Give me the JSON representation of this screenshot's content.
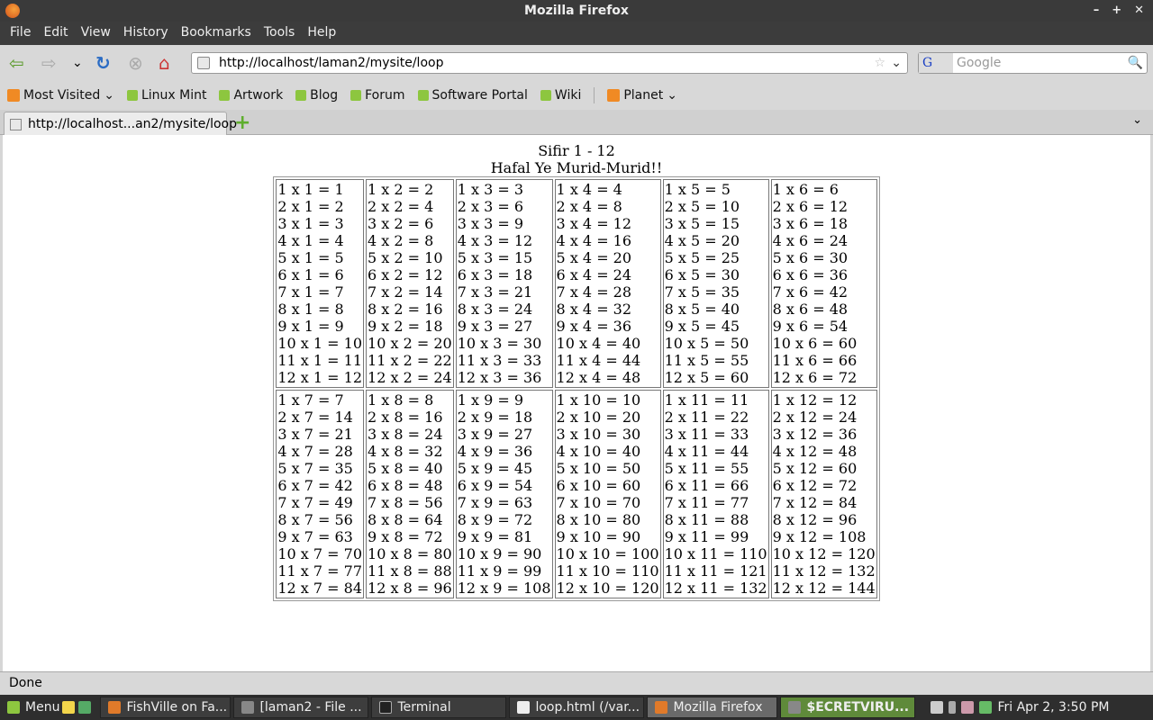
{
  "window": {
    "title": "Mozilla Firefox",
    "min": "–",
    "max": "+",
    "close": "✕"
  },
  "menu": [
    "File",
    "Edit",
    "View",
    "History",
    "Bookmarks",
    "Tools",
    "Help"
  ],
  "nav": {
    "back": "⇦",
    "forward": "⇨",
    "history": "⌄",
    "reload": "↻",
    "stop": "⊗",
    "home": "⌂",
    "url": "http://localhost/laman2/mysite/loop",
    "star": "☆",
    "url_dropdown": "⌄",
    "search_engine": "G",
    "search_placeholder": "Google",
    "search_icon": "🔍"
  },
  "bookmarks": {
    "most_visited": "Most Visited",
    "items": [
      "Linux Mint",
      "Artwork",
      "Blog",
      "Forum",
      "Software Portal",
      "Wiki"
    ],
    "planet": "Planet"
  },
  "tabs": [
    {
      "label": "http://localhost...an2/mysite/loop"
    }
  ],
  "tab_new": "+",
  "tab_list": "⌄",
  "page": {
    "title": "Sifir 1 - 12",
    "subtitle": "Hafal Ye Murid-Murid!!",
    "tables": [
      [
        "1 x 1 = 1",
        "2 x 1 = 2",
        "3 x 1 = 3",
        "4 x 1 = 4",
        "5 x 1 = 5",
        "6 x 1 = 6",
        "7 x 1 = 7",
        "8 x 1 = 8",
        "9 x 1 = 9",
        "10 x 1 = 10",
        "11 x 1 = 11",
        "12 x 1 = 12"
      ],
      [
        "1 x 2 = 2",
        "2 x 2 = 4",
        "3 x 2 = 6",
        "4 x 2 = 8",
        "5 x 2 = 10",
        "6 x 2 = 12",
        "7 x 2 = 14",
        "8 x 2 = 16",
        "9 x 2 = 18",
        "10 x 2 = 20",
        "11 x 2 = 22",
        "12 x 2 = 24"
      ],
      [
        "1 x 3 = 3",
        "2 x 3 = 6",
        "3 x 3 = 9",
        "4 x 3 = 12",
        "5 x 3 = 15",
        "6 x 3 = 18",
        "7 x 3 = 21",
        "8 x 3 = 24",
        "9 x 3 = 27",
        "10 x 3 = 30",
        "11 x 3 = 33",
        "12 x 3 = 36"
      ],
      [
        "1 x 4 = 4",
        "2 x 4 = 8",
        "3 x 4 = 12",
        "4 x 4 = 16",
        "5 x 4 = 20",
        "6 x 4 = 24",
        "7 x 4 = 28",
        "8 x 4 = 32",
        "9 x 4 = 36",
        "10 x 4 = 40",
        "11 x 4 = 44",
        "12 x 4 = 48"
      ],
      [
        "1 x 5 = 5",
        "2 x 5 = 10",
        "3 x 5 = 15",
        "4 x 5 = 20",
        "5 x 5 = 25",
        "6 x 5 = 30",
        "7 x 5 = 35",
        "8 x 5 = 40",
        "9 x 5 = 45",
        "10 x 5 = 50",
        "11 x 5 = 55",
        "12 x 5 = 60"
      ],
      [
        "1 x 6 = 6",
        "2 x 6 = 12",
        "3 x 6 = 18",
        "4 x 6 = 24",
        "5 x 6 = 30",
        "6 x 6 = 36",
        "7 x 6 = 42",
        "8 x 6 = 48",
        "9 x 6 = 54",
        "10 x 6 = 60",
        "11 x 6 = 66",
        "12 x 6 = 72"
      ],
      [
        "1 x 7 = 7",
        "2 x 7 = 14",
        "3 x 7 = 21",
        "4 x 7 = 28",
        "5 x 7 = 35",
        "6 x 7 = 42",
        "7 x 7 = 49",
        "8 x 7 = 56",
        "9 x 7 = 63",
        "10 x 7 = 70",
        "11 x 7 = 77",
        "12 x 7 = 84"
      ],
      [
        "1 x 8 = 8",
        "2 x 8 = 16",
        "3 x 8 = 24",
        "4 x 8 = 32",
        "5 x 8 = 40",
        "6 x 8 = 48",
        "7 x 8 = 56",
        "8 x 8 = 64",
        "9 x 8 = 72",
        "10 x 8 = 80",
        "11 x 8 = 88",
        "12 x 8 = 96"
      ],
      [
        "1 x 9 = 9",
        "2 x 9 = 18",
        "3 x 9 = 27",
        "4 x 9 = 36",
        "5 x 9 = 45",
        "6 x 9 = 54",
        "7 x 9 = 63",
        "8 x 9 = 72",
        "9 x 9 = 81",
        "10 x 9 = 90",
        "11 x 9 = 99",
        "12 x 9 = 108"
      ],
      [
        "1 x 10 = 10",
        "2 x 10 = 20",
        "3 x 10 = 30",
        "4 x 10 = 40",
        "5 x 10 = 50",
        "6 x 10 = 60",
        "7 x 10 = 70",
        "8 x 10 = 80",
        "9 x 10 = 90",
        "10 x 10 = 100",
        "11 x 10 = 110",
        "12 x 10 = 120"
      ],
      [
        "1 x 11 = 11",
        "2 x 11 = 22",
        "3 x 11 = 33",
        "4 x 11 = 44",
        "5 x 11 = 55",
        "6 x 11 = 66",
        "7 x 11 = 77",
        "8 x 11 = 88",
        "9 x 11 = 99",
        "10 x 11 = 110",
        "11 x 11 = 121",
        "12 x 11 = 132"
      ],
      [
        "1 x 12 = 12",
        "2 x 12 = 24",
        "3 x 12 = 36",
        "4 x 12 = 48",
        "5 x 12 = 60",
        "6 x 12 = 72",
        "7 x 12 = 84",
        "8 x 12 = 96",
        "9 x 12 = 108",
        "10 x 12 = 120",
        "11 x 12 = 132",
        "12 x 12 = 144"
      ]
    ]
  },
  "status": "Done",
  "taskbar": {
    "menu": "Menu",
    "tasks": [
      "FishVille on Fa...",
      "[laman2 - File ...",
      "Terminal",
      "loop.html (/var...",
      "Mozilla Firefox",
      "$ECRETVIRU..."
    ],
    "clock": "Fri Apr  2,  3:50 PM"
  }
}
